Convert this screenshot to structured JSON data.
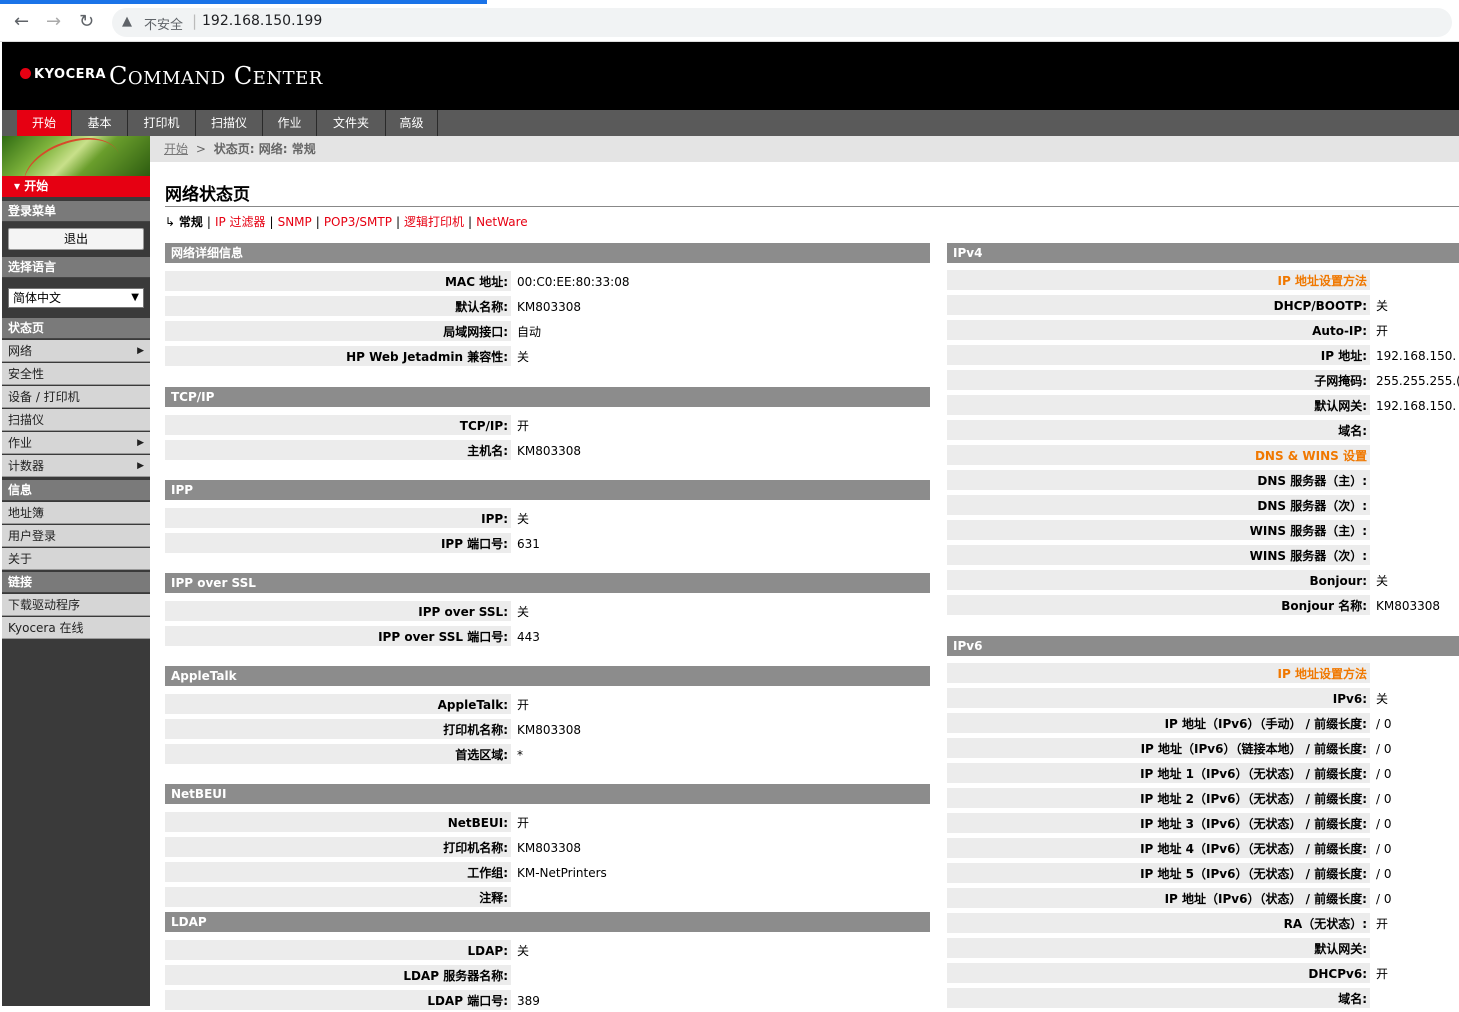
{
  "browser": {
    "back_icon": "back-arrow-icon",
    "forward_icon": "forward-arrow-icon",
    "reload_icon": "reload-icon",
    "security": "不安全",
    "url": "192.168.150.199"
  },
  "header": {
    "brand": "KYOCERA",
    "app_name_cap1": "C",
    "app_name_rest1": "OMMAND",
    "app_name_cap2": "C",
    "app_name_rest2": "ENTER"
  },
  "menu": {
    "tabs": [
      "开始",
      "基本",
      "打印机",
      "扫描仪",
      "作业",
      "文件夹",
      "高级"
    ],
    "active": 0
  },
  "sidebar": {
    "start": "▾ 开始",
    "login_head": "登录菜单",
    "logout": "退出",
    "lang_head": "选择语言",
    "lang_value": "简体中文",
    "status_head": "状态页",
    "status_items": [
      "网络",
      "安全性",
      "设备 / 打印机",
      "扫描仪",
      "作业",
      "计数器"
    ],
    "info_head": "信息",
    "info_items": [
      "地址簿",
      "用户登录",
      "关于"
    ],
    "links_head": "链接",
    "links_items": [
      "下载驱动程序",
      "Kyocera 在线"
    ]
  },
  "breadcrumb": {
    "home": "开始",
    "sep": ">",
    "current": "状态页: 网络: 常规"
  },
  "page": {
    "title": "网络状态页",
    "subnav_current": "常规",
    "subnav_links": [
      "IP 过滤器",
      "SNMP",
      "POP3/SMTP",
      "逻辑打印机",
      "NetWare"
    ]
  },
  "left_sections": [
    {
      "title": "网络详细信息",
      "rows": [
        [
          "MAC 地址:",
          "00:C0:EE:80:33:08"
        ],
        [
          "默认名称:",
          "KM803308"
        ],
        [
          "局域网接口:",
          "自动"
        ],
        [
          "HP Web Jetadmin 兼容性:",
          "关"
        ]
      ]
    },
    {
      "title": "TCP/IP",
      "rows": [
        [
          "TCP/IP:",
          "开"
        ],
        [
          "主机名:",
          "KM803308"
        ]
      ]
    },
    {
      "title": "IPP",
      "rows": [
        [
          "IPP:",
          "关"
        ],
        [
          "IPP 端口号:",
          "631"
        ]
      ]
    },
    {
      "title": "IPP over SSL",
      "rows": [
        [
          "IPP over SSL:",
          "关"
        ],
        [
          "IPP over SSL 端口号:",
          "443"
        ]
      ]
    },
    {
      "title": "AppleTalk",
      "rows": [
        [
          "AppleTalk:",
          "开"
        ],
        [
          "打印机名称:",
          "KM803308"
        ],
        [
          "首选区域:",
          "*"
        ]
      ]
    },
    {
      "title": "NetBEUI",
      "rows": [
        [
          "NetBEUI:",
          "开"
        ],
        [
          "打印机名称:",
          "KM803308"
        ],
        [
          "工作组:",
          "KM-NetPrinters"
        ],
        [
          "注释:",
          ""
        ]
      ]
    },
    {
      "title": "LDAP",
      "rows": [
        [
          "LDAP:",
          "关"
        ],
        [
          "LDAP 服务器名称:",
          ""
        ],
        [
          "LDAP 端口号:",
          "389"
        ]
      ]
    }
  ],
  "right_sections": [
    {
      "title": "IPv4",
      "rows": [
        [
          "IP 地址设置方法",
          "",
          true
        ],
        [
          "DHCP/BOOTP:",
          "关"
        ],
        [
          "Auto-IP:",
          "开"
        ],
        [
          "IP 地址:",
          "192.168.150."
        ],
        [
          "子网掩码:",
          "255.255.255.("
        ],
        [
          "默认网关:",
          "192.168.150."
        ],
        [
          "域名:",
          ""
        ],
        [
          "DNS & WINS 设置",
          "",
          true
        ],
        [
          "DNS 服务器（主）:",
          ""
        ],
        [
          "DNS 服务器（次）:",
          ""
        ],
        [
          "WINS 服务器（主）:",
          ""
        ],
        [
          "WINS 服务器（次）:",
          ""
        ],
        [
          "Bonjour:",
          "关"
        ],
        [
          "Bonjour 名称:",
          "KM803308"
        ]
      ]
    },
    {
      "title": "IPv6",
      "rows": [
        [
          "IP 地址设置方法",
          "",
          true
        ],
        [
          "IPv6:",
          "关"
        ],
        [
          "IP 地址（IPv6）（手动） / 前缀长度:",
          "/ 0"
        ],
        [
          "IP 地址（IPv6）（链接本地） / 前缀长度:",
          "/ 0"
        ],
        [
          "IP 地址 1（IPv6）（无状态） / 前缀长度:",
          "/ 0"
        ],
        [
          "IP 地址 2（IPv6）（无状态） / 前缀长度:",
          "/ 0"
        ],
        [
          "IP 地址 3（IPv6）（无状态） / 前缀长度:",
          "/ 0"
        ],
        [
          "IP 地址 4（IPv6）（无状态） / 前缀长度:",
          "/ 0"
        ],
        [
          "IP 地址 5（IPv6）（无状态） / 前缀长度:",
          "/ 0"
        ],
        [
          "IP 地址（IPv6）（状态） / 前缀长度:",
          "/ 0"
        ],
        [
          "RA（无状态）:",
          "开"
        ],
        [
          "默认网关:",
          ""
        ],
        [
          "DHCPv6:",
          "开"
        ],
        [
          "域名:",
          ""
        ]
      ]
    }
  ]
}
